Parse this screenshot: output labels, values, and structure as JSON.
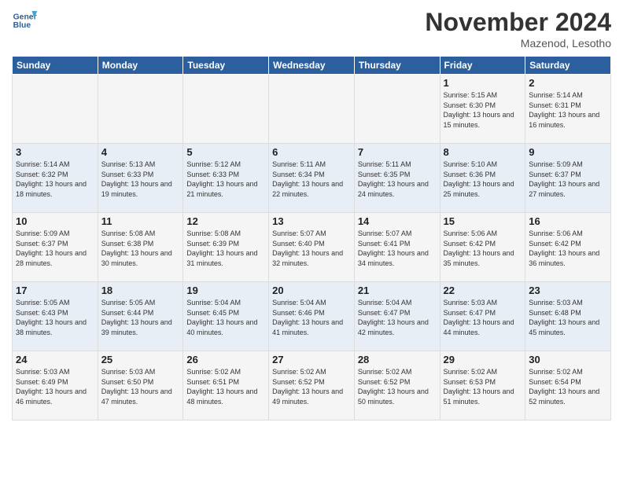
{
  "header": {
    "logo_line1": "General",
    "logo_line2": "Blue",
    "title": "November 2024",
    "subtitle": "Mazenod, Lesotho"
  },
  "weekdays": [
    "Sunday",
    "Monday",
    "Tuesday",
    "Wednesday",
    "Thursday",
    "Friday",
    "Saturday"
  ],
  "weeks": [
    [
      {
        "day": "",
        "info": ""
      },
      {
        "day": "",
        "info": ""
      },
      {
        "day": "",
        "info": ""
      },
      {
        "day": "",
        "info": ""
      },
      {
        "day": "",
        "info": ""
      },
      {
        "day": "1",
        "info": "Sunrise: 5:15 AM\nSunset: 6:30 PM\nDaylight: 13 hours and 15 minutes."
      },
      {
        "day": "2",
        "info": "Sunrise: 5:14 AM\nSunset: 6:31 PM\nDaylight: 13 hours and 16 minutes."
      }
    ],
    [
      {
        "day": "3",
        "info": "Sunrise: 5:14 AM\nSunset: 6:32 PM\nDaylight: 13 hours and 18 minutes."
      },
      {
        "day": "4",
        "info": "Sunrise: 5:13 AM\nSunset: 6:33 PM\nDaylight: 13 hours and 19 minutes."
      },
      {
        "day": "5",
        "info": "Sunrise: 5:12 AM\nSunset: 6:33 PM\nDaylight: 13 hours and 21 minutes."
      },
      {
        "day": "6",
        "info": "Sunrise: 5:11 AM\nSunset: 6:34 PM\nDaylight: 13 hours and 22 minutes."
      },
      {
        "day": "7",
        "info": "Sunrise: 5:11 AM\nSunset: 6:35 PM\nDaylight: 13 hours and 24 minutes."
      },
      {
        "day": "8",
        "info": "Sunrise: 5:10 AM\nSunset: 6:36 PM\nDaylight: 13 hours and 25 minutes."
      },
      {
        "day": "9",
        "info": "Sunrise: 5:09 AM\nSunset: 6:37 PM\nDaylight: 13 hours and 27 minutes."
      }
    ],
    [
      {
        "day": "10",
        "info": "Sunrise: 5:09 AM\nSunset: 6:37 PM\nDaylight: 13 hours and 28 minutes."
      },
      {
        "day": "11",
        "info": "Sunrise: 5:08 AM\nSunset: 6:38 PM\nDaylight: 13 hours and 30 minutes."
      },
      {
        "day": "12",
        "info": "Sunrise: 5:08 AM\nSunset: 6:39 PM\nDaylight: 13 hours and 31 minutes."
      },
      {
        "day": "13",
        "info": "Sunrise: 5:07 AM\nSunset: 6:40 PM\nDaylight: 13 hours and 32 minutes."
      },
      {
        "day": "14",
        "info": "Sunrise: 5:07 AM\nSunset: 6:41 PM\nDaylight: 13 hours and 34 minutes."
      },
      {
        "day": "15",
        "info": "Sunrise: 5:06 AM\nSunset: 6:42 PM\nDaylight: 13 hours and 35 minutes."
      },
      {
        "day": "16",
        "info": "Sunrise: 5:06 AM\nSunset: 6:42 PM\nDaylight: 13 hours and 36 minutes."
      }
    ],
    [
      {
        "day": "17",
        "info": "Sunrise: 5:05 AM\nSunset: 6:43 PM\nDaylight: 13 hours and 38 minutes."
      },
      {
        "day": "18",
        "info": "Sunrise: 5:05 AM\nSunset: 6:44 PM\nDaylight: 13 hours and 39 minutes."
      },
      {
        "day": "19",
        "info": "Sunrise: 5:04 AM\nSunset: 6:45 PM\nDaylight: 13 hours and 40 minutes."
      },
      {
        "day": "20",
        "info": "Sunrise: 5:04 AM\nSunset: 6:46 PM\nDaylight: 13 hours and 41 minutes."
      },
      {
        "day": "21",
        "info": "Sunrise: 5:04 AM\nSunset: 6:47 PM\nDaylight: 13 hours and 42 minutes."
      },
      {
        "day": "22",
        "info": "Sunrise: 5:03 AM\nSunset: 6:47 PM\nDaylight: 13 hours and 44 minutes."
      },
      {
        "day": "23",
        "info": "Sunrise: 5:03 AM\nSunset: 6:48 PM\nDaylight: 13 hours and 45 minutes."
      }
    ],
    [
      {
        "day": "24",
        "info": "Sunrise: 5:03 AM\nSunset: 6:49 PM\nDaylight: 13 hours and 46 minutes."
      },
      {
        "day": "25",
        "info": "Sunrise: 5:03 AM\nSunset: 6:50 PM\nDaylight: 13 hours and 47 minutes."
      },
      {
        "day": "26",
        "info": "Sunrise: 5:02 AM\nSunset: 6:51 PM\nDaylight: 13 hours and 48 minutes."
      },
      {
        "day": "27",
        "info": "Sunrise: 5:02 AM\nSunset: 6:52 PM\nDaylight: 13 hours and 49 minutes."
      },
      {
        "day": "28",
        "info": "Sunrise: 5:02 AM\nSunset: 6:52 PM\nDaylight: 13 hours and 50 minutes."
      },
      {
        "day": "29",
        "info": "Sunrise: 5:02 AM\nSunset: 6:53 PM\nDaylight: 13 hours and 51 minutes."
      },
      {
        "day": "30",
        "info": "Sunrise: 5:02 AM\nSunset: 6:54 PM\nDaylight: 13 hours and 52 minutes."
      }
    ]
  ]
}
